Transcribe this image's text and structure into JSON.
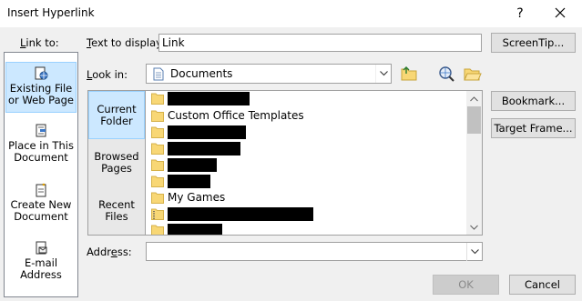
{
  "dialog": {
    "title": "Insert Hyperlink",
    "help_symbol": "?"
  },
  "link_to": {
    "label": "Link to:",
    "items": [
      {
        "label": "Existing File\nor Web Page",
        "icon": "existing-file-web-icon",
        "selected": true
      },
      {
        "label": "Place in This\nDocument",
        "icon": "place-in-document-icon",
        "selected": false
      },
      {
        "label": "Create New\nDocument",
        "icon": "new-document-icon",
        "selected": false
      },
      {
        "label": "E-mail\nAddress",
        "icon": "email-icon",
        "selected": false
      }
    ]
  },
  "text_to_display": {
    "label": "Text to display:",
    "value": "Link"
  },
  "look_in": {
    "label": "Look in:",
    "value": "Documents",
    "icon": "documents-icon"
  },
  "places": [
    {
      "label": "Current\nFolder",
      "selected": true
    },
    {
      "label": "Browsed\nPages",
      "selected": false
    },
    {
      "label": "Recent\nFiles",
      "selected": false
    }
  ],
  "files": [
    {
      "name": "",
      "redacted": true
    },
    {
      "name": "Custom Office Templates",
      "redacted": false
    },
    {
      "name": "",
      "redacted": true
    },
    {
      "name": "",
      "redacted": true
    },
    {
      "name": "",
      "redacted": true
    },
    {
      "name": "",
      "redacted": true
    },
    {
      "name": "My Games",
      "redacted": false
    },
    {
      "name": "",
      "redacted": true
    },
    {
      "name": "",
      "redacted": true
    }
  ],
  "address": {
    "label": "Address:",
    "value": ""
  },
  "buttons": {
    "screentip": "ScreenTip...",
    "bookmark": "Bookmark...",
    "target_frame": "Target Frame...",
    "ok": "OK",
    "cancel": "Cancel"
  },
  "colors": {
    "selection": "#cce8ff",
    "folder": "#f8d775"
  }
}
